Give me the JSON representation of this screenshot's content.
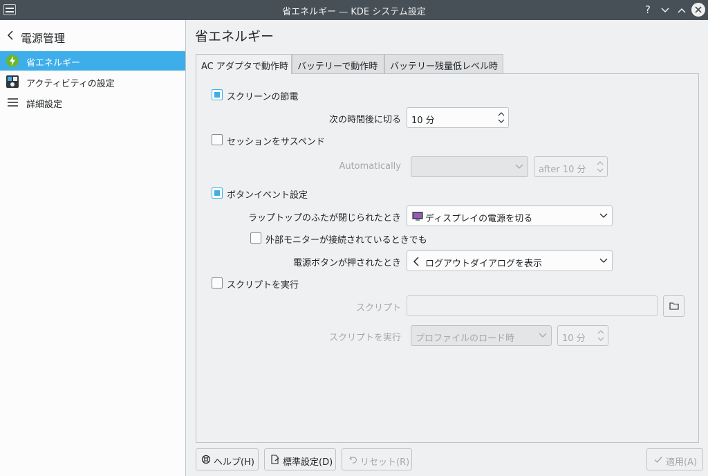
{
  "window": {
    "title": "省エネルギー — KDE システム設定"
  },
  "titlebar_buttons": {
    "help": "?",
    "minimize": "⌄",
    "maximize": "⌃"
  },
  "sidebar": {
    "header": "電源管理",
    "items": [
      {
        "label": "省エネルギー",
        "icon": "energy-icon",
        "selected": true
      },
      {
        "label": "アクティビティの設定",
        "icon": "activities-icon",
        "selected": false
      },
      {
        "label": "詳細設定",
        "icon": "menu-icon",
        "selected": false
      }
    ]
  },
  "main": {
    "title": "省エネルギー",
    "tabs": [
      {
        "label": "AC アダプタで動作時",
        "active": true
      },
      {
        "label": "バッテリーで動作時",
        "active": false
      },
      {
        "label": "バッテリー残量低レベル時",
        "active": false
      }
    ],
    "screen": {
      "checkbox_label": "スクリーンの節電",
      "checked": true,
      "off_after_label": "次の時間後に切る",
      "off_after_value": "10 分"
    },
    "suspend": {
      "checkbox_label": "セッションをサスペンド",
      "checked": false,
      "auto_label": "Automatically",
      "auto_value": "",
      "after_value": "after 10 分"
    },
    "buttons": {
      "checkbox_label": "ボタンイベント設定",
      "checked": true,
      "lid_label": "ラップトップのふたが閉じられたとき",
      "lid_value": "ディスプレイの電源を切る",
      "external_monitor_label": "外部モニターが接続されているときでも",
      "external_monitor_checked": false,
      "power_label": "電源ボタンが押されたとき",
      "power_value": "ログアウトダイアログを表示"
    },
    "script": {
      "checkbox_label": "スクリプトを実行",
      "checked": false,
      "script_label": "スクリプト",
      "script_value": "",
      "run_label": "スクリプトを実行",
      "run_value": "プロファイルのロード時",
      "run_after_value": "10 分"
    }
  },
  "footer": {
    "help": "ヘルプ(H)",
    "defaults": "標準設定(D)",
    "reset": "リセット(R)",
    "apply": "適用(A)"
  },
  "colors": {
    "accent": "#3daee9",
    "titlebar": "#475057",
    "energy_green": "#6cb52d"
  }
}
